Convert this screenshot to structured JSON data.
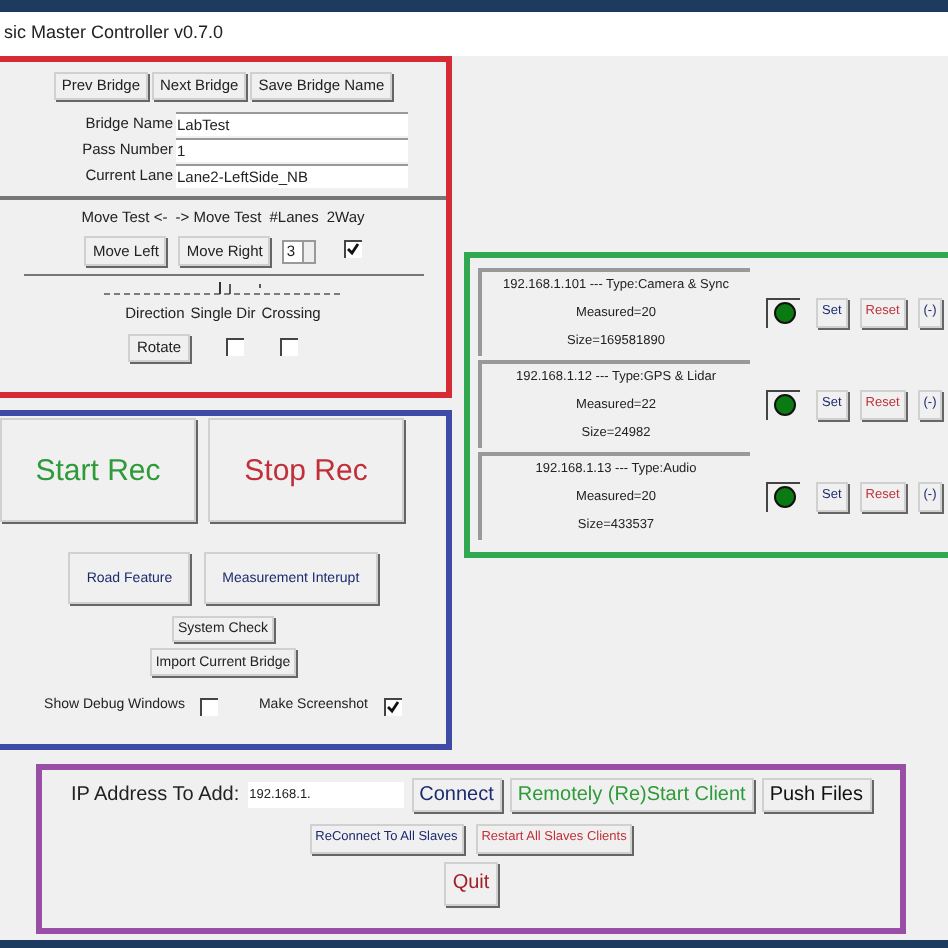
{
  "window": {
    "title": "sic Master Controller v0.7.0"
  },
  "bridge_panel": {
    "buttons": [
      "Prev Bridge",
      "Next Bridge",
      "Save Bridge Name"
    ],
    "fields": [
      {
        "label": "Bridge Name",
        "value": "LabTest"
      },
      {
        "label": "Pass Number",
        "value": "1"
      },
      {
        "label": "Current Lane",
        "value": "Lane2-LeftSide_NB"
      }
    ],
    "move_labels": [
      "Move Test <-",
      "-> Move Test",
      "#Lanes",
      "2Way"
    ],
    "move_left": "Move Left",
    "move_right": "Move Right",
    "lanes": "3",
    "two_way": true,
    "direction_labels": [
      "Direction",
      "Single Dir",
      "Crossing"
    ],
    "rotate": "Rotate",
    "single_dir": false,
    "crossing": false
  },
  "record_panel": {
    "start": "Start Rec",
    "stop": "Stop Rec",
    "buttons": [
      "Road Feature",
      "Measurement Interupt"
    ],
    "system_check": "System Check",
    "import": "Import Current Bridge",
    "options": [
      {
        "label": "Show Debug Windows",
        "checked": false
      },
      {
        "label": "Make Screenshot",
        "checked": true
      }
    ]
  },
  "devices": [
    {
      "title": "192.168.1.101  ---  Type:Camera & Sync",
      "measured": "Measured=20",
      "size": "Size=169581890",
      "color": "#0b7a12",
      "buttons": [
        "Set",
        "Reset",
        "(-)"
      ]
    },
    {
      "title": "192.168.1.12  ---  Type:GPS & Lidar",
      "measured": "Measured=22",
      "size": "Size=24982",
      "color": "#0b7a12",
      "buttons": [
        "Set",
        "Reset",
        "(-)"
      ]
    },
    {
      "title": "192.168.1.13  ---  Type:Audio",
      "measured": "Measured=20",
      "size": "Size=433537",
      "color": "#0b7a12",
      "buttons": [
        "Set",
        "Reset",
        "(-)"
      ]
    }
  ],
  "connect_panel": {
    "ip_label": "IP Address To Add:",
    "ip_value": "192.168.1.",
    "buttons": [
      {
        "label": "Connect",
        "color": "#1c2a6e"
      },
      {
        "label": "Remotely (Re)Start Client",
        "color": "#2e9a3a"
      },
      {
        "label": "Push Files",
        "color": "#111111"
      }
    ],
    "slave_buttons": [
      {
        "label": "ReConnect To All Slaves",
        "color": "#1c2a6e"
      },
      {
        "label": "Restart All Slaves Clients",
        "color": "#c0303a"
      }
    ],
    "quit": "Quit"
  }
}
